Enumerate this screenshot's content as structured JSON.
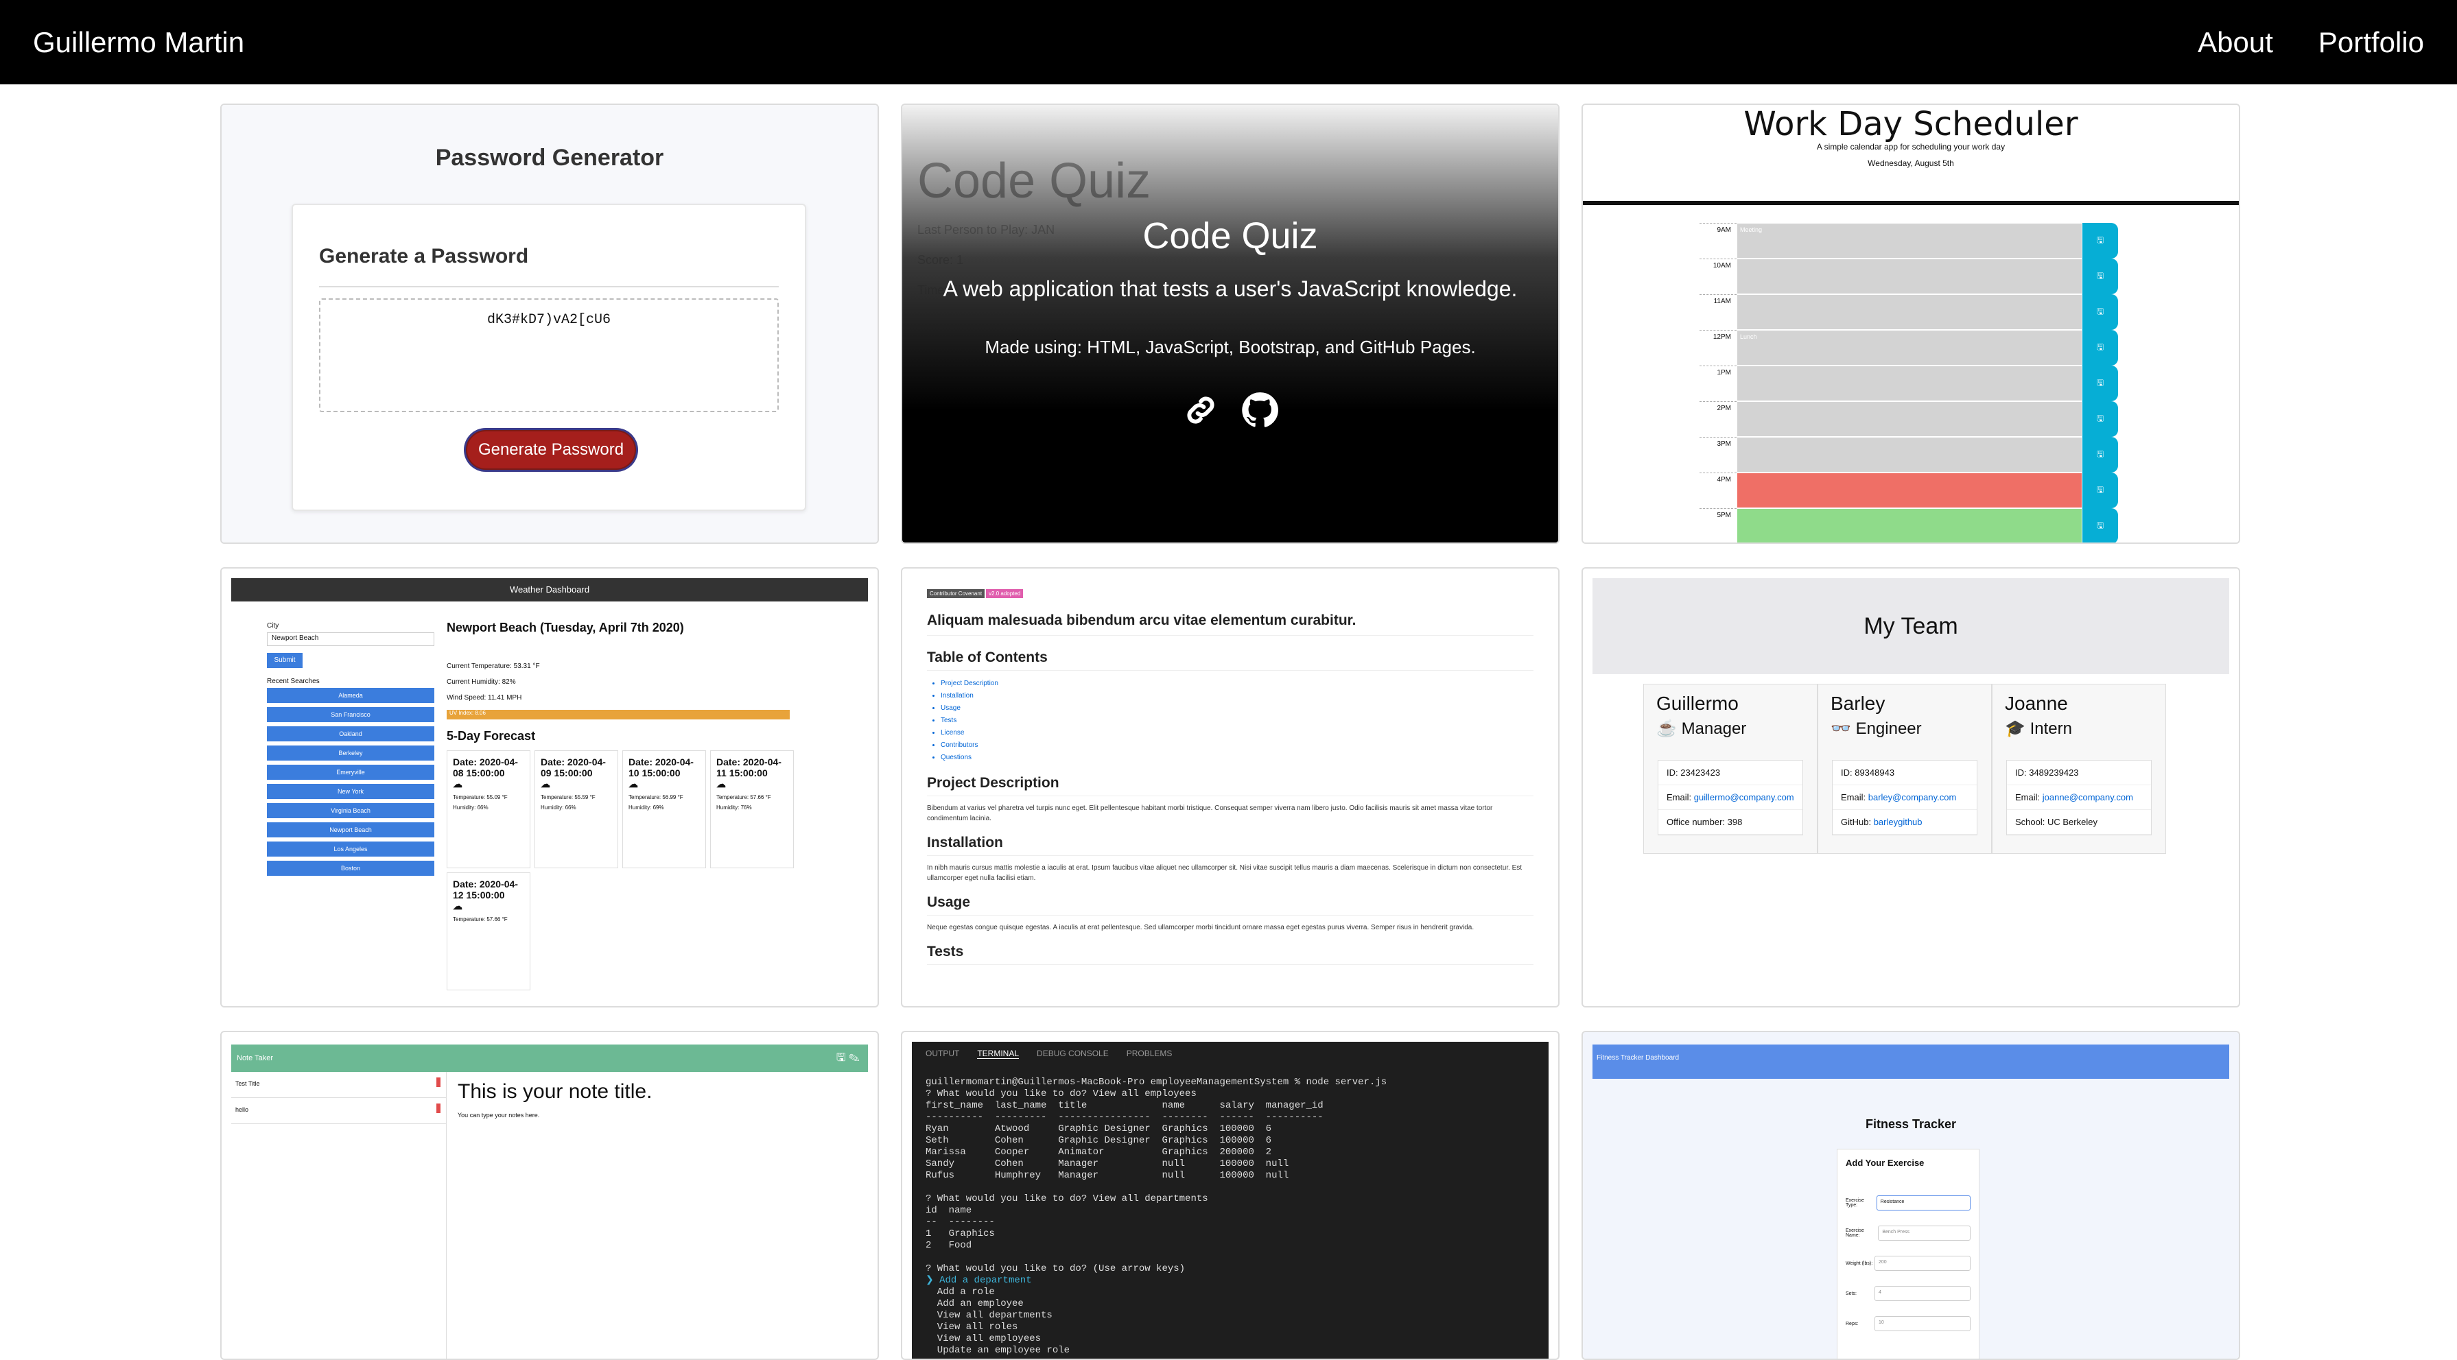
{
  "nav": {
    "brand": "Guillermo Martin",
    "links": [
      "About",
      "Portfolio"
    ]
  },
  "password": {
    "title": "Password Generator",
    "subtitle": "Generate a Password",
    "output": "dK3#kD7)vA2[cU6",
    "button": "Generate Password"
  },
  "quiz": {
    "bg_title": "Code Quiz",
    "bg_lines": [
      "Last Person to Play: JAN",
      "Score: 1",
      "Time: 57"
    ],
    "title": "Code Quiz",
    "description": "A web application that tests a user's JavaScript knowledge.",
    "made_using": "Made using: HTML, JavaScript, Bootstrap, and GitHub Pages."
  },
  "scheduler": {
    "title": "Work Day Scheduler",
    "subtitle": "A simple calendar app for scheduling your work day",
    "date": "Wednesday, August 5th",
    "rows": [
      {
        "hour": "9AM",
        "text": "Meeting",
        "color": "#d3d3d3"
      },
      {
        "hour": "10AM",
        "text": "",
        "color": "#d3d3d3"
      },
      {
        "hour": "11AM",
        "text": "",
        "color": "#d3d3d3"
      },
      {
        "hour": "12PM",
        "text": "Lunch",
        "color": "#d3d3d3"
      },
      {
        "hour": "1PM",
        "text": "",
        "color": "#d3d3d3"
      },
      {
        "hour": "2PM",
        "text": "",
        "color": "#d3d3d3"
      },
      {
        "hour": "3PM",
        "text": "",
        "color": "#d3d3d3"
      },
      {
        "hour": "4PM",
        "text": "",
        "color": "#ef6f66"
      },
      {
        "hour": "5PM",
        "text": "",
        "color": "#8fdb8a"
      }
    ]
  },
  "weather": {
    "bar": "Weather Dashboard",
    "city_label": "City",
    "city_value": "Newport Beach",
    "submit": "Submit",
    "recent_label": "Recent Searches",
    "cities": [
      "Alameda",
      "San Francisco",
      "Oakland",
      "Berkeley",
      "Emeryville",
      "New York",
      "Virginia Beach",
      "Newport Beach",
      "Los Angeles",
      "Boston"
    ],
    "heading": "Newport Beach (Tuesday, April 7th 2020)",
    "temp": "Current Temperature: 53.31 °F",
    "humidity": "Current Humidity: 82%",
    "wind": "Wind Speed: 11.41 MPH",
    "uv": "UV Index: 8.06",
    "forecast_title": "5-Day Forecast",
    "forecast": [
      {
        "date": "Date: 2020-04-08 15:00:00",
        "temp": "Temperature: 55.09 °F",
        "hum": "Humidity: 66%"
      },
      {
        "date": "Date: 2020-04-09 15:00:00",
        "temp": "Temperature: 55.59 °F",
        "hum": "Humidity: 66%"
      },
      {
        "date": "Date: 2020-04-10 15:00:00",
        "temp": "Temperature: 56.99 °F",
        "hum": "Humidity: 69%"
      },
      {
        "date": "Date: 2020-04-11 15:00:00",
        "temp": "Temperature: 57.66 °F",
        "hum": "Humidity: 76%"
      },
      {
        "date": "Date: 2020-04-12 15:00:00",
        "temp": "Temperature: 57.66 °F",
        "hum": ""
      }
    ]
  },
  "readme": {
    "badge1": "Contributor Covenant",
    "badge2": "v2.0 adopted",
    "title": "Aliquam malesuada bibendum arcu vitae elementum curabitur.",
    "toc": "Table of Contents",
    "toc_items": [
      "Project Description",
      "Installation",
      "Usage",
      "Tests",
      "License",
      "Contributors",
      "Questions"
    ],
    "h_desc": "Project Description",
    "p_desc": "Bibendum at varius vel pharetra vel turpis nunc eget. Elit pellentesque habitant morbi tristique. Consequat semper viverra nam libero justo. Odio facilisis mauris sit amet massa vitae tortor condimentum lacinia.",
    "h_install": "Installation",
    "p_install": "In nibh mauris cursus mattis molestie a iaculis at erat. Ipsum faucibus vitae aliquet nec ullamcorper sit. Nisi vitae suscipit tellus mauris a diam maecenas. Scelerisque in dictum non consectetur. Est ullamcorper eget nulla facilisi etiam.",
    "h_usage": "Usage",
    "p_usage": "Neque egestas congue quisque egestas. A iaculis at erat pellentesque. Sed ullamcorper morbi tincidunt ornare massa eget egestas purus viverra. Semper risus in hendrerit gravida.",
    "h_tests": "Tests"
  },
  "team": {
    "title": "My Team",
    "members": [
      {
        "name": "Guillermo",
        "role": "Manager",
        "icon": "☕",
        "id": "ID: 23423423",
        "email_label": "Email:",
        "email": "guillermo@company.com",
        "extra": "Office number: 398",
        "extra_link": ""
      },
      {
        "name": "Barley",
        "role": "Engineer",
        "icon": "👓",
        "id": "ID: 89348943",
        "email_label": "Email:",
        "email": "barley@company.com",
        "extra": "GitHub:",
        "extra_link": "barleygithub"
      },
      {
        "name": "Joanne",
        "role": "Intern",
        "icon": "🎓",
        "id": "ID: 3489239423",
        "email_label": "Email:",
        "email": "joanne@company.com",
        "extra": "School: UC Berkeley",
        "extra_link": ""
      }
    ]
  },
  "notes": {
    "bar": "Note Taker",
    "items": [
      "Test Title",
      "hello"
    ],
    "title": "This is your note title.",
    "text": "You can type your notes here."
  },
  "terminal": {
    "tabs": [
      "OUTPUT",
      "TERMINAL",
      "DEBUG CONSOLE",
      "PROBLEMS"
    ],
    "active_tab": "TERMINAL",
    "lines": [
      "guillermomartin@Guillermos-MacBook-Pro employeeManagementSystem % node server.js",
      "? What would you like to do? View all employees",
      "first_name  last_name  title             name      salary  manager_id",
      "----------  ---------  ----------------  --------  ------  ----------",
      "Ryan        Atwood     Graphic Designer  Graphics  100000  6",
      "Seth        Cohen      Graphic Designer  Graphics  100000  6",
      "Marissa     Cooper     Animator          Graphics  200000  2",
      "Sandy       Cohen      Manager           null      100000  null",
      "Rufus       Humphrey   Manager           null      100000  null",
      "",
      "? What would you like to do? View all departments",
      "id  name",
      "--  --------",
      "1   Graphics",
      "2   Food",
      "",
      "? What would you like to do? (Use arrow keys)",
      "❯ Add a department",
      "  Add a role",
      "  Add an employee",
      "  View all departments",
      "  View all roles",
      "  View all employees",
      "  Update an employee role"
    ]
  },
  "fitness": {
    "bar": "Fitness Tracker Dashboard",
    "title": "Fitness Tracker",
    "card_title": "Add Your Exercise",
    "fields": [
      {
        "label": "Exercise Type:",
        "value": "Resistance"
      },
      {
        "label": "Exercise Name:",
        "value": "Bench Press"
      },
      {
        "label": "Weight (lbs):",
        "value": "200"
      },
      {
        "label": "Sets:",
        "value": "4"
      },
      {
        "label": "Reps:",
        "value": "10"
      }
    ]
  }
}
